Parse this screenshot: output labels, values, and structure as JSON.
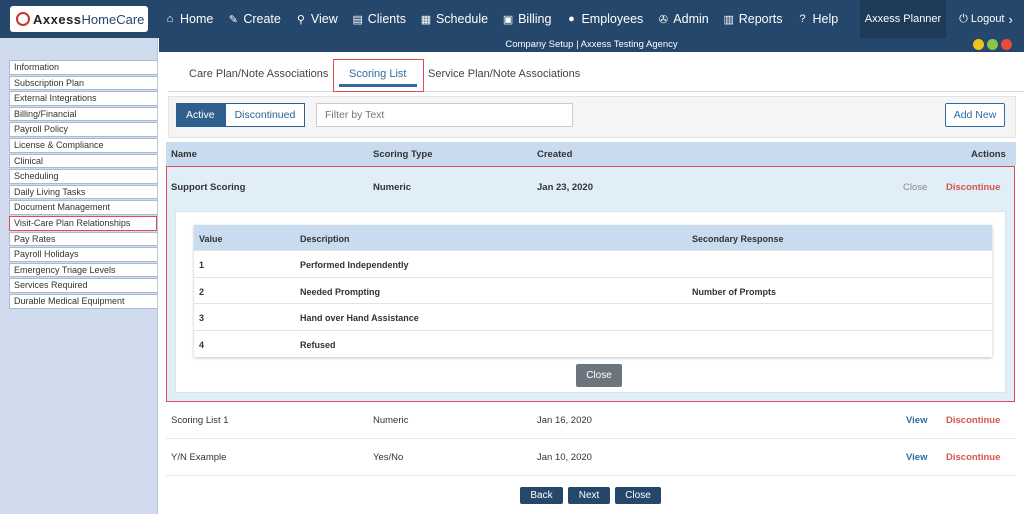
{
  "app": {
    "logo_text": "Axxess",
    "logo_text2": "HomeCare"
  },
  "nav": {
    "items": [
      {
        "label": "Home",
        "icon": "home-icon",
        "glyph": "⌂"
      },
      {
        "label": "Create",
        "icon": "pencil-icon",
        "glyph": "✎"
      },
      {
        "label": "View",
        "icon": "search-icon",
        "glyph": "⚲"
      },
      {
        "label": "Clients",
        "icon": "id-card-icon",
        "glyph": "▤"
      },
      {
        "label": "Schedule",
        "icon": "calendar-icon",
        "glyph": "▦"
      },
      {
        "label": "Billing",
        "icon": "money-icon",
        "glyph": "▣"
      },
      {
        "label": "Employees",
        "icon": "user-icon",
        "glyph": "●"
      },
      {
        "label": "Admin",
        "icon": "wrench-icon",
        "glyph": "✇"
      },
      {
        "label": "Reports",
        "icon": "bar-chart-icon",
        "glyph": "▥"
      },
      {
        "label": "Help",
        "icon": "question-icon",
        "glyph": "?"
      }
    ],
    "planner": "Axxess Planner",
    "logout": "Logout",
    "logout_glyph": "⏻",
    "logout_chevron": "›"
  },
  "titlebar": {
    "text": "Company Setup | Axxess Testing Agency"
  },
  "window_controls": {
    "colors": [
      "#f0c419",
      "#8bc34a",
      "#e84c3d"
    ]
  },
  "sidebar": {
    "items": [
      {
        "label": "Information"
      },
      {
        "label": "Subscription Plan"
      },
      {
        "label": "External Integrations"
      },
      {
        "label": "Billing/Financial"
      },
      {
        "label": "Payroll Policy"
      },
      {
        "label": "License & Compliance"
      },
      {
        "label": "Clinical"
      },
      {
        "label": "Scheduling"
      },
      {
        "label": "Daily Living Tasks"
      },
      {
        "label": "Document Management"
      },
      {
        "label": "Visit-Care Plan Relationships"
      },
      {
        "label": "Pay Rates"
      },
      {
        "label": "Payroll Holidays"
      },
      {
        "label": "Emergency Triage Levels"
      },
      {
        "label": "Services Required"
      },
      {
        "label": "Durable Medical Equipment"
      }
    ]
  },
  "tabs": [
    "Care Plan/Note Associations",
    "Scoring List",
    "Service Plan/Note Associations"
  ],
  "toolbar": {
    "active_label": "Active",
    "discontinued_label": "Discontinued",
    "filter_placeholder": "Filter by Text",
    "add_new_label": "Add New"
  },
  "table": {
    "headers": [
      "Name",
      "Scoring Type",
      "Created",
      "Actions"
    ],
    "expanded_row": {
      "name": "Support Scoring",
      "type": "Numeric",
      "created": "Jan 23, 2020",
      "close_label": "Close",
      "discontinue_label": "Discontinue",
      "detail": {
        "headers": [
          "Value",
          "Description",
          "Secondary Response"
        ],
        "rows": [
          {
            "value": "1",
            "description": "Performed Independently",
            "secondary": ""
          },
          {
            "value": "2",
            "description": "Needed Prompting",
            "secondary": "Number of Prompts"
          },
          {
            "value": "3",
            "description": "Hand over Hand Assistance",
            "secondary": ""
          },
          {
            "value": "4",
            "description": "Refused",
            "secondary": ""
          }
        ],
        "close_button": "Close"
      }
    },
    "rows": [
      {
        "name": "Scoring List 1",
        "type": "Numeric",
        "created": "Jan 16, 2020",
        "view": "View",
        "discontinue": "Discontinue"
      },
      {
        "name": "Y/N Example",
        "type": "Yes/No",
        "created": "Jan 10, 2020",
        "view": "View",
        "discontinue": "Discontinue"
      }
    ]
  },
  "footer": {
    "back": "Back",
    "next": "Next",
    "close": "Close"
  }
}
